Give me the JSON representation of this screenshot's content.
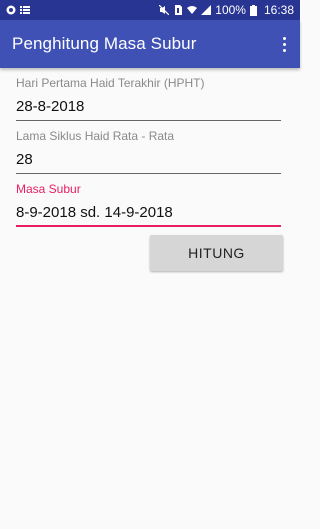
{
  "statusbar": {
    "battery_percent": "100%",
    "time": "16:38"
  },
  "appbar": {
    "title": "Penghitung Masa Subur"
  },
  "form": {
    "hpht": {
      "label": "Hari Pertama Haid Terakhir (HPHT)",
      "value": "28-8-2018"
    },
    "cycle": {
      "label": "Lama Siklus Haid Rata - Rata",
      "value": "28"
    },
    "fertile": {
      "label": "Masa Subur",
      "value": "8-9-2018 sd. 14-9-2018"
    }
  },
  "actions": {
    "calculate_label": "HITUNG"
  },
  "colors": {
    "status_bar": "#283593",
    "app_bar": "#3f51b5",
    "accent": "#e91e63"
  }
}
